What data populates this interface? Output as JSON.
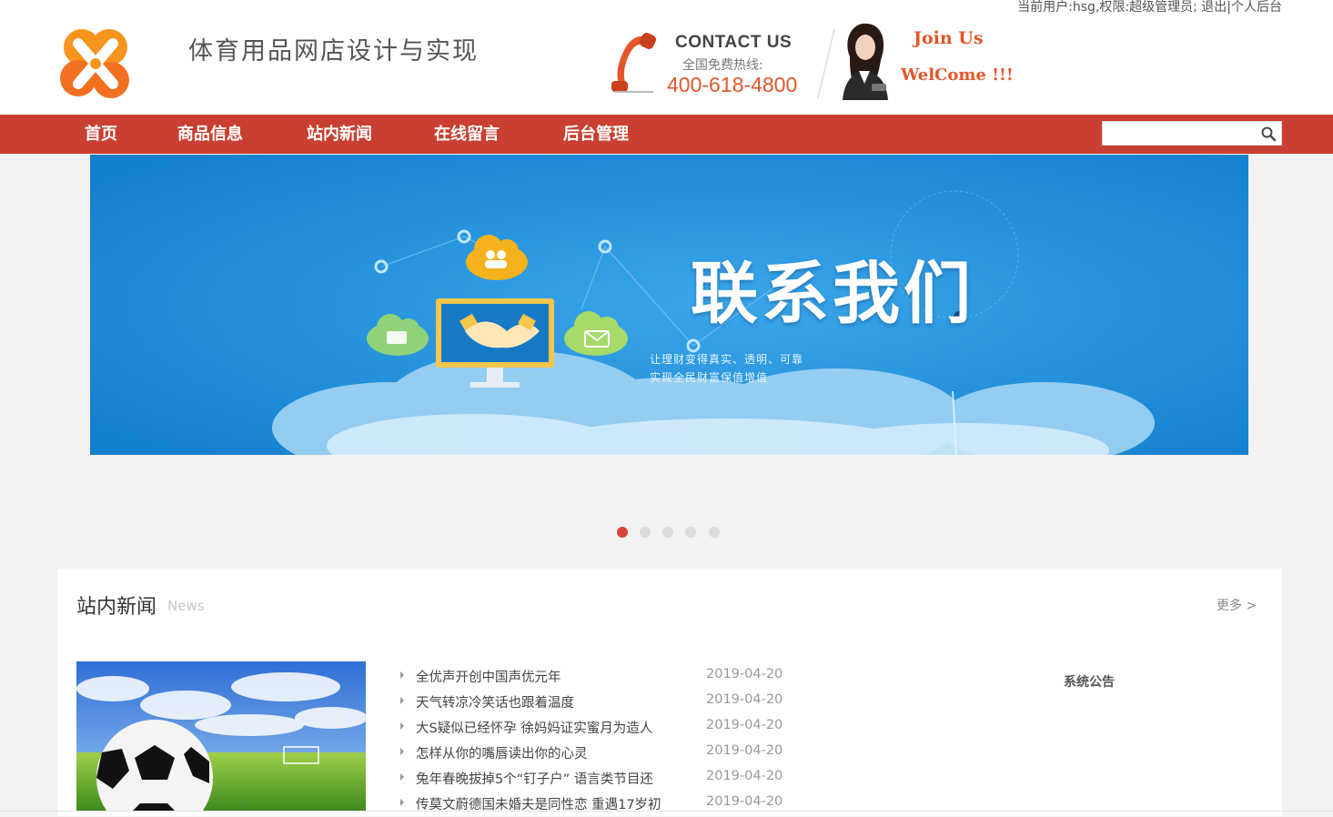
{
  "user_bar": {
    "user_text": "当前用户:hsg,权限:超级管理员;",
    "logout": "退出",
    "separator": "|",
    "personal_backend": "个人后台"
  },
  "header": {
    "site_title": "体育用品网店设计与实现",
    "logo_icon": "orange-x-flower-logo",
    "contact_title": "CONTACT US",
    "contact_subtitle": "全国免费热线:",
    "contact_phone": "400-618-4800",
    "join_line1": "Join Us",
    "join_line2": "WelCome !!!"
  },
  "nav": {
    "items": [
      "首页",
      "商品信息",
      "站内新闻",
      "在线留言",
      "后台管理"
    ],
    "search_value": "",
    "search_icon": "search-icon"
  },
  "banner": {
    "heading": "联系我们",
    "sub_line1": "让理财变得真实、透明、可靠",
    "sub_line2": "实现全民财富保值增值",
    "slide_count": 5,
    "active_slide": 1
  },
  "news": {
    "title": "站内新闻",
    "subtitle": "News",
    "more": "更多 >",
    "items": [
      {
        "title": "全优声开创中国声优元年",
        "date": "2019-04-20"
      },
      {
        "title": "天气转凉冷笑话也跟着温度",
        "date": "2019-04-20"
      },
      {
        "title": "大S疑似已经怀孕 徐妈妈证实蜜月为造人",
        "date": "2019-04-20"
      },
      {
        "title": "怎样从你的嘴唇读出你的心灵",
        "date": "2019-04-20"
      },
      {
        "title": "兔年春晚拔掉5个“钉子户” 语言类节目还",
        "date": "2019-04-20"
      },
      {
        "title": "传莫文蔚德国未婚夫是同性恋 重遇17岁初",
        "date": "2019-04-20"
      }
    ],
    "notice_title": "系统公告"
  },
  "colors": {
    "nav_bg": "#c94032",
    "accent": "#e2562a",
    "banner_blue": "#1f8fd8",
    "active_dot": "#d9423a"
  }
}
